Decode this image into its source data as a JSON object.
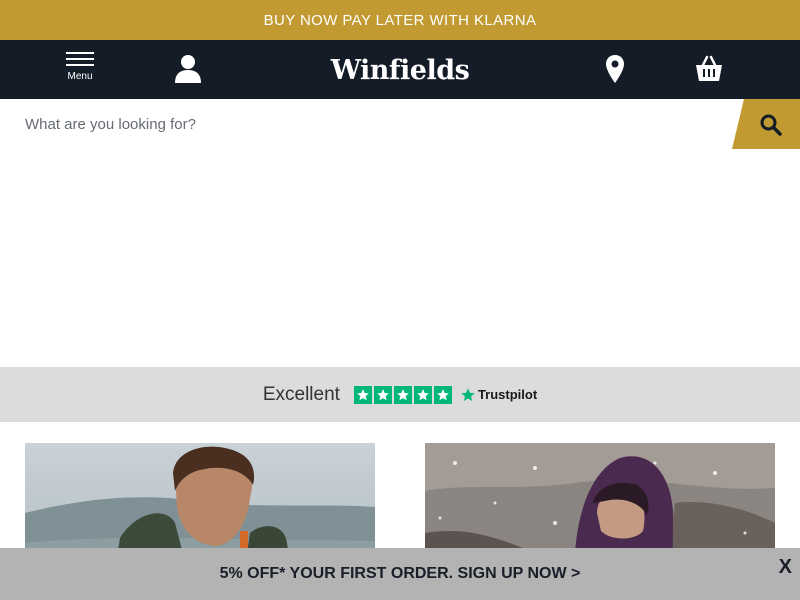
{
  "promo": {
    "text": "BUY NOW PAY LATER WITH KLARNA"
  },
  "header": {
    "menu_label": "Menu",
    "logo_text": "Winfields",
    "account_icon": "user-icon",
    "store_icon": "location-pin-icon",
    "basket_icon": "basket-icon"
  },
  "search": {
    "placeholder": "What are you looking for?",
    "value": ""
  },
  "trustpilot": {
    "label": "Excellent",
    "rating_stars": 5,
    "brand": "Trustpilot",
    "star_color": "#00b67a"
  },
  "cards": [
    {
      "image": "man-outdoors-photo"
    },
    {
      "image": "woman-hooded-jacket-snow-photo"
    }
  ],
  "signup": {
    "text": "5% OFF* YOUR FIRST ORDER. SIGN UP NOW >",
    "close_label": "X"
  },
  "colors": {
    "accent": "#c19a31",
    "header_bg": "#141c27",
    "trust_bg": "#dcdcdc",
    "signup_bg": "#b3b3b3"
  }
}
